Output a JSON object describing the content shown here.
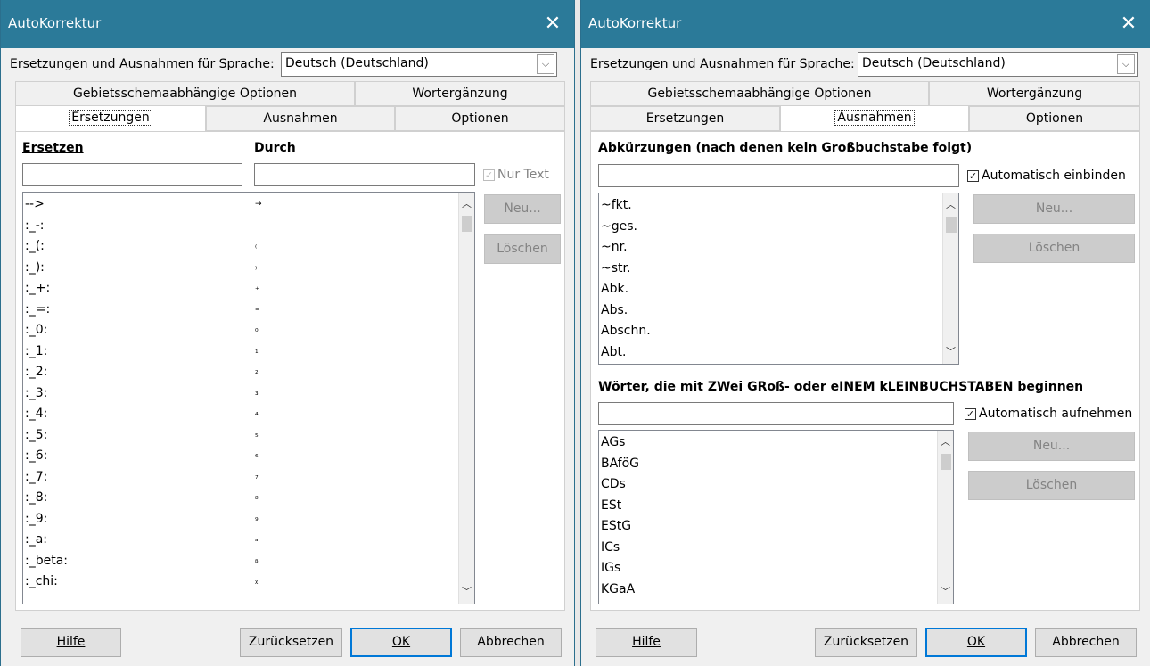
{
  "left": {
    "title": "AutoKorrektur",
    "language_label": "Ersetzungen und Ausnahmen für Sprache:",
    "language_value": "Deutsch (Deutschland)",
    "tabs": [
      "Gebietsschemaabhängige Optionen",
      "Wortergänzung",
      "Ersetzungen",
      "Ausnahmen",
      "Optionen"
    ],
    "active_tab": "Ersetzungen",
    "col_replace": "Ersetzen",
    "col_with": "Durch",
    "text_only": "Nur Text",
    "new_button": "Neu...",
    "delete_button": "Löschen",
    "rows": [
      {
        "from": "-->",
        "to": "→"
      },
      {
        "from": ":_-:",
        "to": "₋"
      },
      {
        "from": ":_(:",
        "to": "₍"
      },
      {
        "from": ":_):",
        "to": "₎"
      },
      {
        "from": ":_+:",
        "to": "₊"
      },
      {
        "from": ":_=:",
        "to": "₌"
      },
      {
        "from": ":_0:",
        "to": "₀"
      },
      {
        "from": ":_1:",
        "to": "₁"
      },
      {
        "from": ":_2:",
        "to": "₂"
      },
      {
        "from": ":_3:",
        "to": "₃"
      },
      {
        "from": ":_4:",
        "to": "₄"
      },
      {
        "from": ":_5:",
        "to": "₅"
      },
      {
        "from": ":_6:",
        "to": "₆"
      },
      {
        "from": ":_7:",
        "to": "₇"
      },
      {
        "from": ":_8:",
        "to": "₈"
      },
      {
        "from": ":_9:",
        "to": "₉"
      },
      {
        "from": ":_a:",
        "to": "ₐ"
      },
      {
        "from": ":_beta:",
        "to": "ᵦ"
      },
      {
        "from": ":_chi:",
        "to": "ᵪ"
      }
    ],
    "help_button": "Hilfe",
    "reset_button": "Zurücksetzen",
    "ok_button": "OK",
    "cancel_button": "Abbrechen"
  },
  "right": {
    "title": "AutoKorrektur",
    "language_label": "Ersetzungen und Ausnahmen für Sprache:",
    "language_value": "Deutsch (Deutschland)",
    "tabs": [
      "Gebietsschemaabhängige Optionen",
      "Wortergänzung",
      "Ersetzungen",
      "Ausnahmen",
      "Optionen"
    ],
    "active_tab": "Ausnahmen",
    "abbrev_heading": "Abkürzungen (nach denen kein Großbuchstabe folgt)",
    "abbrev_auto": "Automatisch einbinden",
    "abbrev_rows": [
      "~fkt.",
      "~ges.",
      "~nr.",
      "~str.",
      "Abk.",
      "Abs.",
      "Abschn.",
      "Abt."
    ],
    "words_heading": "Wörter, die mit ZWei GRoß- oder eINEM kLEINBUCHSTABEN beginnen",
    "words_auto": "Automatisch aufnehmen",
    "words_rows": [
      "AGs",
      "BAföG",
      "CDs",
      "ESt",
      "EStG",
      "ICs",
      "IGs",
      "KGaA"
    ],
    "new_button": "Neu...",
    "delete_button": "Löschen",
    "help_button": "Hilfe",
    "reset_button": "Zurücksetzen",
    "ok_button": "OK",
    "cancel_button": "Abbrechen"
  },
  "colors": {
    "titlebar": "#2b7a99",
    "accent": "#0078d7",
    "window_bg": "#f0f0f0"
  }
}
